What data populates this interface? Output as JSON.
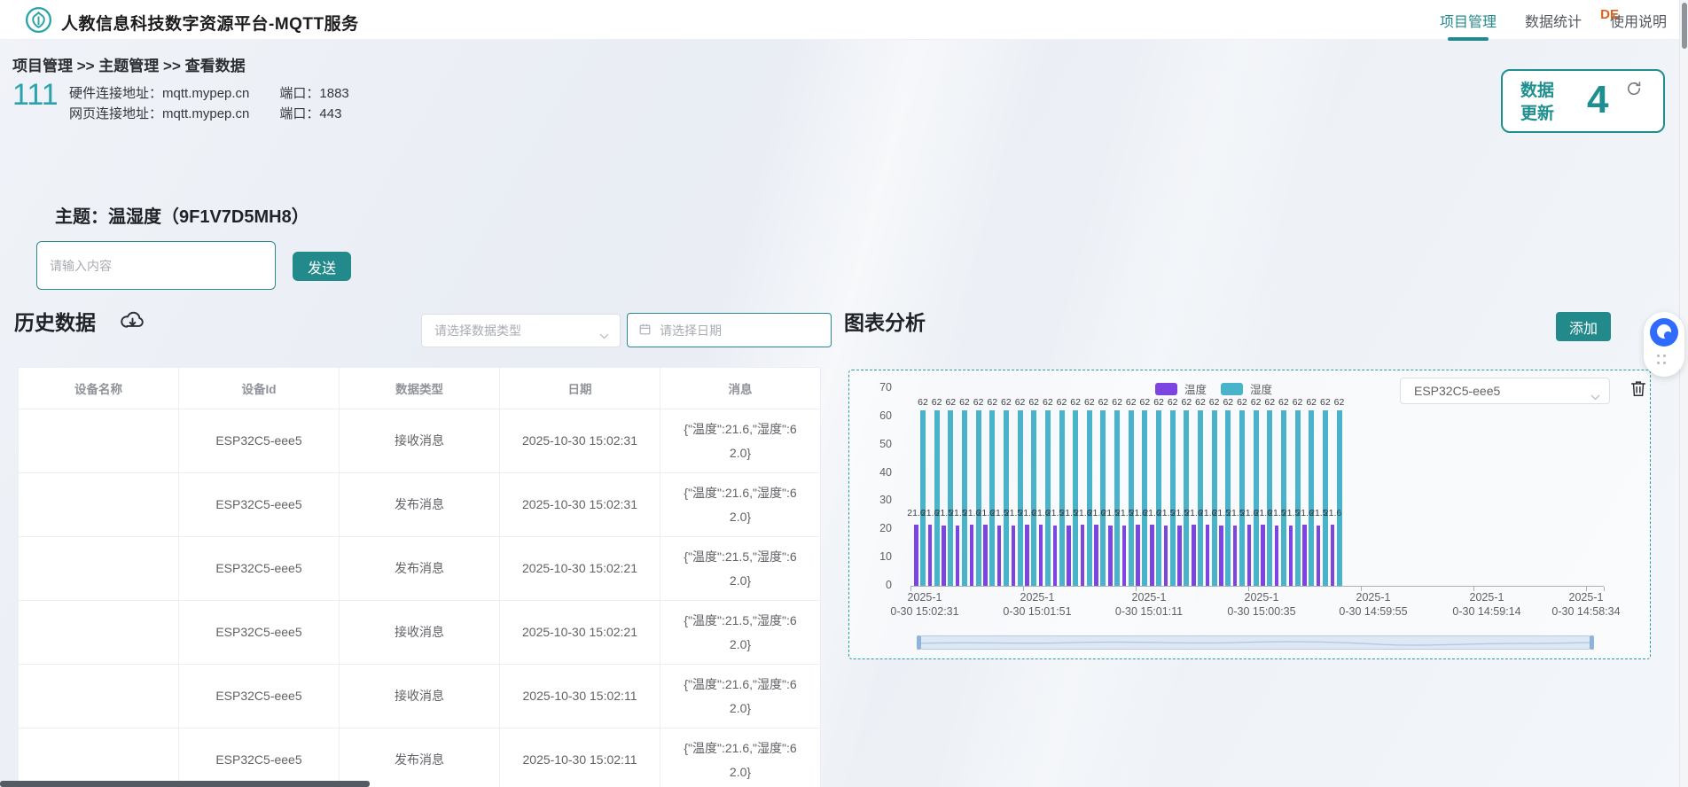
{
  "header": {
    "title": "人教信息科技数字资源平台-MQTT服务",
    "nav": [
      {
        "label": "项目管理",
        "active": true
      },
      {
        "label": "数据统计",
        "active": false
      },
      {
        "label": "使用说明",
        "active": false
      }
    ],
    "overlay_badge": "DE"
  },
  "breadcrumb": "项目管理 >> 主题管理 >> 查看数据",
  "project": {
    "id": "111",
    "hardware_label": "硬件连接地址：",
    "hardware_address": "mqtt.mypep.cn",
    "hardware_port_label": "端口：",
    "hardware_port": "1883",
    "web_label": "网页连接地址：",
    "web_address": "mqtt.mypep.cn",
    "web_port_label": "端口：",
    "web_port": "443"
  },
  "refresh_box": {
    "label": "数据更新",
    "count": "4"
  },
  "topic": {
    "title": "主题：温湿度（9F1V7D5MH8）",
    "input_placeholder": "请输入内容",
    "send_label": "发送"
  },
  "history": {
    "title": "历史数据",
    "type_placeholder": "请选择数据类型",
    "date_placeholder": "请选择日期",
    "table": {
      "headers": [
        "设备名称",
        "设备Id",
        "数据类型",
        "日期",
        "消息"
      ],
      "rows": [
        [
          "",
          "ESP32C5-eee5",
          "接收消息",
          "2025-10-30 15:02:31",
          "{\"温度\":21.6,\"湿度\":62.0}"
        ],
        [
          "",
          "ESP32C5-eee5",
          "发布消息",
          "2025-10-30 15:02:31",
          "{\"温度\":21.6,\"湿度\":62.0}"
        ],
        [
          "",
          "ESP32C5-eee5",
          "发布消息",
          "2025-10-30 15:02:21",
          "{\"温度\":21.5,\"湿度\":62.0}"
        ],
        [
          "",
          "ESP32C5-eee5",
          "接收消息",
          "2025-10-30 15:02:21",
          "{\"温度\":21.5,\"湿度\":62.0}"
        ],
        [
          "",
          "ESP32C5-eee5",
          "接收消息",
          "2025-10-30 15:02:11",
          "{\"温度\":21.6,\"湿度\":62.0}"
        ],
        [
          "",
          "ESP32C5-eee5",
          "发布消息",
          "2025-10-30 15:02:11",
          "{\"温度\":21.6,\"湿度\":62.0}"
        ]
      ]
    }
  },
  "analysis": {
    "title": "图表分析",
    "add_label": "添加",
    "device_selected": "ESP32C5-eee5"
  },
  "chart_data": {
    "type": "bar",
    "legend": [
      "温度",
      "湿度"
    ],
    "legend_position": "top",
    "series": [
      {
        "name": "温度",
        "color": "#7d45e0",
        "values": [
          21.6,
          21.6,
          21.5,
          21.5,
          21.6,
          21.6,
          21.5,
          21.5,
          21.6,
          21.6,
          21.5,
          21.5,
          21.6,
          21.6,
          21.5,
          21.5,
          21.6,
          21.6,
          21.5,
          21.5,
          21.6,
          21.6,
          21.5,
          21.5,
          21.6,
          21.6,
          21.5,
          21.5,
          21.6,
          21.5,
          21.6
        ]
      },
      {
        "name": "湿度",
        "color": "#48b3c9",
        "values": [
          62,
          62,
          62,
          62,
          62,
          62,
          62,
          62,
          62,
          62,
          62,
          62,
          62,
          62,
          62,
          62,
          62,
          62,
          62,
          62,
          62,
          62,
          62,
          62,
          62,
          62,
          62,
          62,
          62,
          62,
          62
        ]
      }
    ],
    "x_axis_labels": [
      {
        "line1": "2025-1",
        "line2": "0-30 15:02:31"
      },
      {
        "line1": "2025-1",
        "line2": "0-30 15:01:51"
      },
      {
        "line1": "2025-1",
        "line2": "0-30 15:01:11"
      },
      {
        "line1": "2025-1",
        "line2": "0-30 15:00:35"
      },
      {
        "line1": "2025-1",
        "line2": "0-30 14:59:55"
      },
      {
        "line1": "2025-1",
        "line2": "0-30 14:59:14"
      },
      {
        "line1": "2025-1",
        "line2": "0-30 14:58:34"
      }
    ],
    "ylim": [
      0,
      70
    ],
    "yticks": [
      0,
      10,
      20,
      30,
      40,
      50,
      60,
      70
    ],
    "grid": false,
    "value_labels_visible": true,
    "datazoom_slider": true
  },
  "accent_colors": {
    "teal_primary": "#238a8c",
    "teal_light": "#2ba3ab",
    "purple_bar": "#7d45e0",
    "teal_bar": "#48b3c9"
  }
}
